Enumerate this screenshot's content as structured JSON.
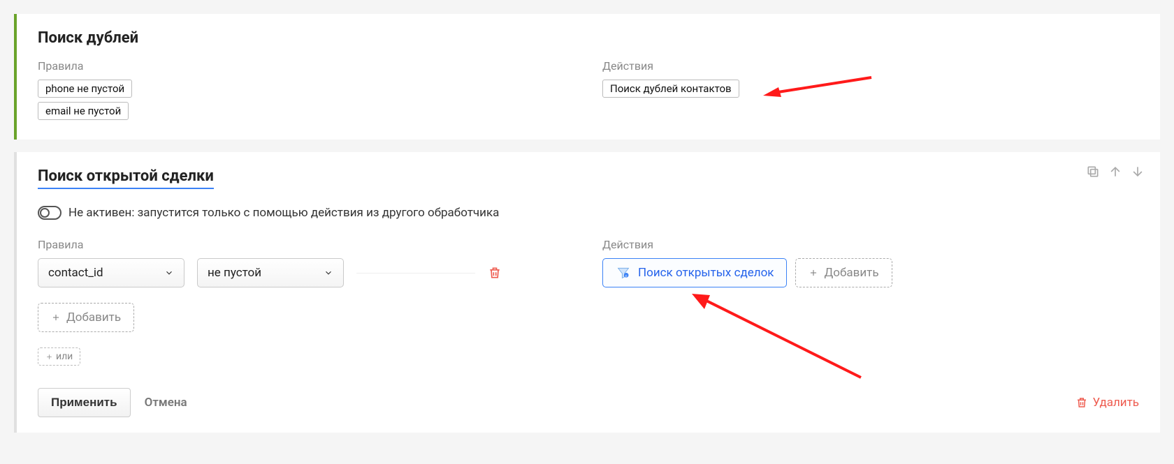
{
  "panel1": {
    "title": "Поиск дублей",
    "rules_label": "Правила",
    "actions_label": "Действия",
    "rule_chips": [
      "phone не пустой",
      "email не пустой"
    ],
    "action_chip": "Поиск дублей контактов"
  },
  "panel2": {
    "title": "Поиск открытой сделки",
    "toggle_text": "Не активен: запустится только с помощью действия из другого обработчика",
    "rules_label": "Правила",
    "actions_label": "Действия",
    "rule_field_select": "contact_id",
    "rule_op_select": "не пустой",
    "action_card_label": "Поиск открытых сделок",
    "add_action_label": "Добавить",
    "add_rule_label": "Добавить",
    "add_or_label": "или",
    "apply_label": "Применить",
    "cancel_label": "Отмена",
    "delete_label": "Удалить"
  }
}
